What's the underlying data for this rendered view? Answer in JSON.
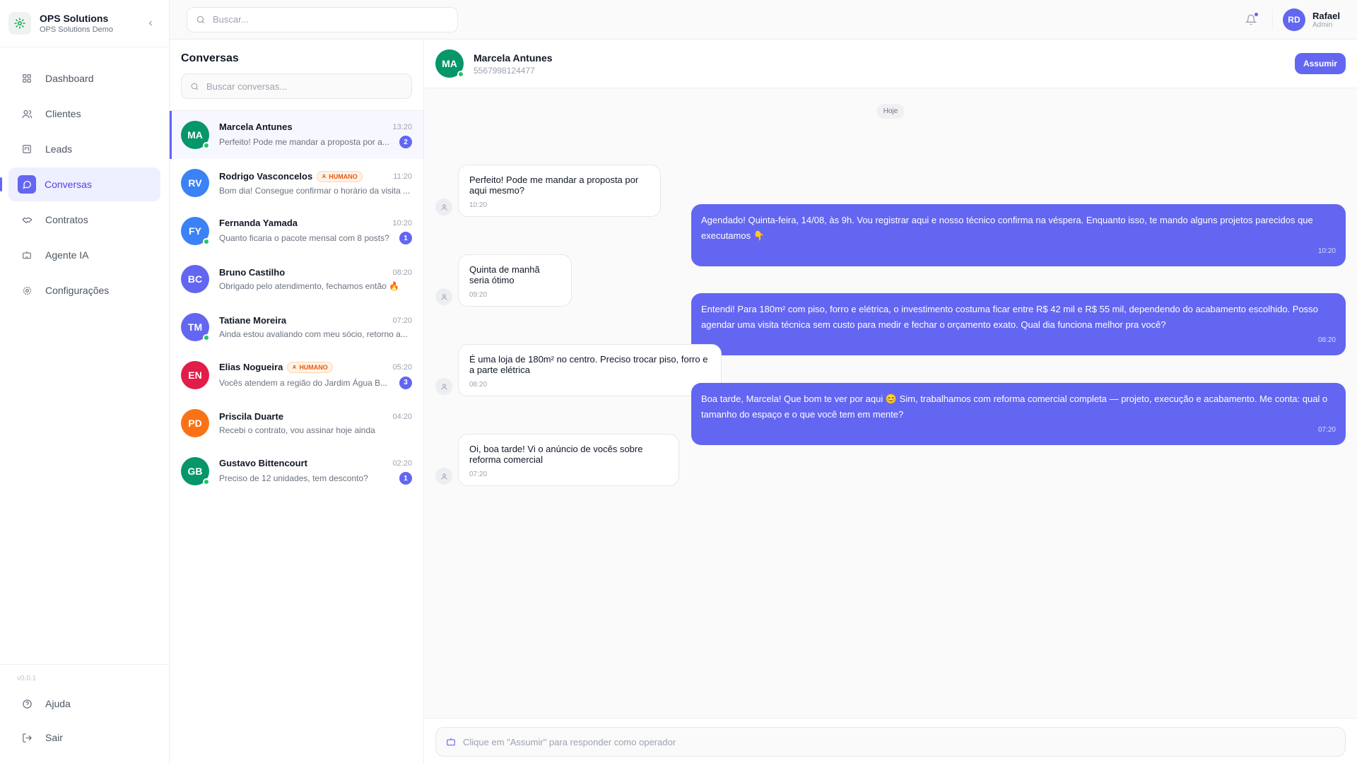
{
  "brand": {
    "name": "OPS Solutions",
    "subtitle": "OPS Solutions Demo"
  },
  "nav": [
    {
      "label": "Dashboard",
      "icon": "grid-icon"
    },
    {
      "label": "Clientes",
      "icon": "users-icon"
    },
    {
      "label": "Leads",
      "icon": "kanban-icon"
    },
    {
      "label": "Conversas",
      "icon": "chat-icon",
      "active": true
    },
    {
      "label": "Contratos",
      "icon": "handshake-icon"
    },
    {
      "label": "Agente IA",
      "icon": "bot-icon"
    },
    {
      "label": "Configurações",
      "icon": "gear-icon"
    }
  ],
  "version": "v0.0.1",
  "bottom_nav": [
    {
      "label": "Ajuda",
      "icon": "help-icon"
    },
    {
      "label": "Sair",
      "icon": "logout-icon"
    }
  ],
  "topbar": {
    "search_placeholder": "Buscar...",
    "user": {
      "initials": "RD",
      "name": "Rafael",
      "role": "Admin"
    }
  },
  "conversations": {
    "title": "Conversas",
    "search_placeholder": "Buscar conversas...",
    "items": [
      {
        "initials": "MA",
        "name": "Marcela Antunes",
        "time": "13:20",
        "preview": "Perfeito! Pode me mandar a proposta por a...",
        "badge": "2",
        "color": "#059669",
        "online": true,
        "active": true
      },
      {
        "initials": "RV",
        "name": "Rodrigo Vasconcelos",
        "tag": "HUMANO",
        "time": "11:20",
        "preview": "Bom dia! Consegue confirmar o horário da visita ...",
        "color": "#3b82f6"
      },
      {
        "initials": "FY",
        "name": "Fernanda Yamada",
        "time": "10:20",
        "preview": "Quanto ficaria o pacote mensal com 8 posts?",
        "badge": "1",
        "color": "#3b82f6",
        "online": true
      },
      {
        "initials": "BC",
        "name": "Bruno Castilho",
        "time": "08:20",
        "preview": "Obrigado pelo atendimento, fechamos então 🔥",
        "color": "#6366f1"
      },
      {
        "initials": "TM",
        "name": "Tatiane Moreira",
        "time": "07:20",
        "preview": "Ainda estou avaliando com meu sócio, retorno a...",
        "color": "#6366f1",
        "online": true
      },
      {
        "initials": "EN",
        "name": "Elias Nogueira",
        "tag": "HUMANO",
        "time": "05:20",
        "preview": "Vocês atendem a região do Jardim Água B...",
        "badge": "3",
        "color": "#e11d48"
      },
      {
        "initials": "PD",
        "name": "Priscila Duarte",
        "time": "04:20",
        "preview": "Recebi o contrato, vou assinar hoje ainda",
        "color": "#f97316"
      },
      {
        "initials": "GB",
        "name": "Gustavo Bittencourt",
        "time": "02:20",
        "preview": "Preciso de 12 unidades, tem desconto?",
        "badge": "1",
        "color": "#059669",
        "online": true
      }
    ]
  },
  "chat": {
    "contact": {
      "initials": "MA",
      "name": "Marcela Antunes",
      "phone": "5567998124477"
    },
    "assume_label": "Assumir",
    "day_label": "Hoje",
    "messages": [
      {
        "dir": "in",
        "text": "Perfeito! Pode me mandar a proposta por aqui mesmo?",
        "time": "10:20"
      },
      {
        "dir": "out",
        "text": "Agendado! Quinta-feira, 14/08, às 9h. Vou registrar aqui e nosso técnico confirma na véspera. Enquanto isso, te mando alguns projetos parecidos que executamos 👇",
        "time": "10:20"
      },
      {
        "dir": "in",
        "text": "Quinta de manhã seria ótimo",
        "time": "09:20"
      },
      {
        "dir": "out",
        "text": "Entendi! Para 180m² com piso, forro e elétrica, o investimento costuma ficar entre R$ 42 mil e R$ 55 mil, dependendo do acabamento escolhido. Posso agendar uma visita técnica sem custo para medir e fechar o orçamento exato. Qual dia funciona melhor pra você?",
        "time": "08:20"
      },
      {
        "dir": "in",
        "text": "É uma loja de 180m² no centro. Preciso trocar piso, forro e a parte elétrica",
        "time": "08:20"
      },
      {
        "dir": "out",
        "text": "Boa tarde, Marcela! Que bom te ver por aqui 😊 Sim, trabalhamos com reforma comercial completa — projeto, execução e acabamento. Me conta: qual o tamanho do espaço e o que você tem em mente?",
        "time": "07:20"
      },
      {
        "dir": "in",
        "text": "Oi, boa tarde! Vi o anúncio de vocês sobre reforma comercial",
        "time": "07:20"
      }
    ],
    "composer_placeholder": "Clique em \"Assumir\" para responder como operador"
  }
}
